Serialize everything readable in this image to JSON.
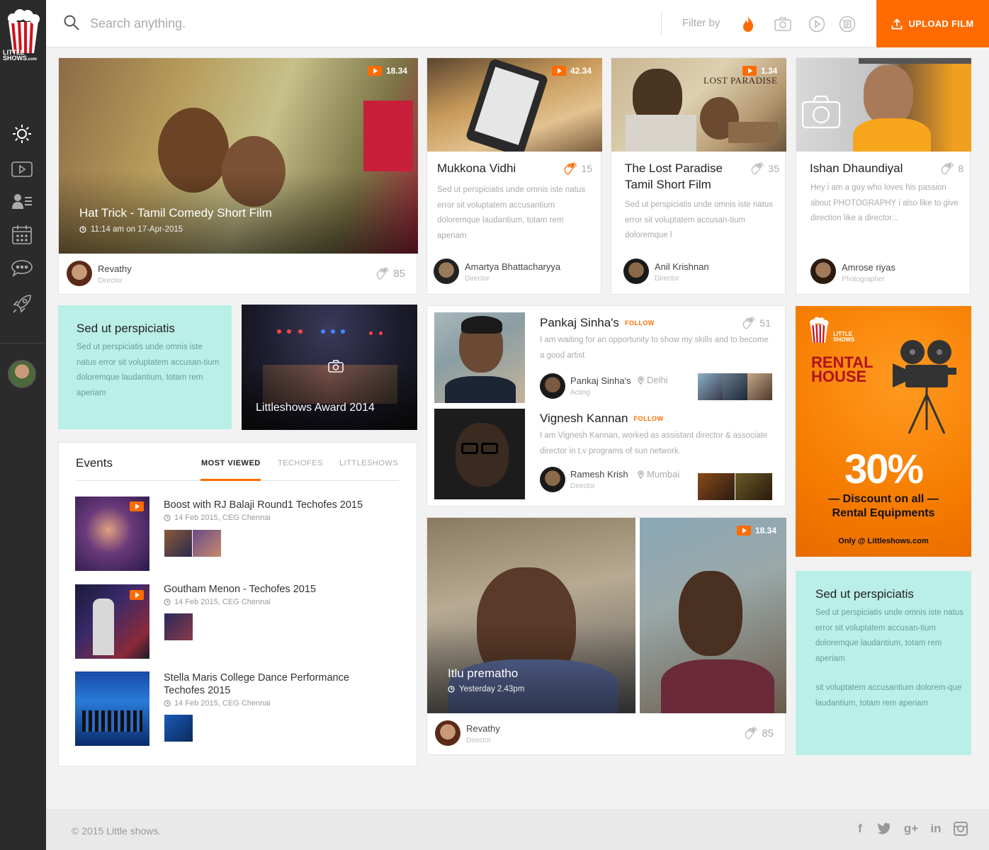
{
  "brand": {
    "logo_text_1": "LITTLE",
    "logo_text_2": "SHOWS",
    "logo_suffix": ".com"
  },
  "search": {
    "placeholder": "Search anything."
  },
  "filter": {
    "label": "Filter by",
    "options": [
      "trending-icon",
      "camera-icon",
      "play-icon",
      "document-icon"
    ]
  },
  "upload": {
    "label": "UPLOAD FILM"
  },
  "sidebar": {
    "items": [
      "sun-icon",
      "video-icon",
      "profiles-icon",
      "calendar-icon",
      "chat-icon",
      "rocket-icon"
    ]
  },
  "featured": {
    "title": "Hat Trick - Tamil Comedy Short Film",
    "time": "11:14 am on 17-Apr-2015",
    "duration": "18.34",
    "author": "Revathy",
    "role": "Director",
    "claps": "85"
  },
  "cards": [
    {
      "title": "Mukkona Vidhi",
      "duration": "42.34",
      "claps": "15",
      "desc": "Sed ut perspiciatis unde omnis iste natus error sit voluptatem accusantium doloremque laudantium, totam rem aperiam",
      "author": "Amartya Bhattacharyya",
      "role": "Director"
    },
    {
      "title": "The Lost Paradise Tamil Short Film",
      "duration": "1.34",
      "claps": "35",
      "desc": "Sed ut perspiciatis unde omnis iste natus error sit voluptatem accusan-tium doloremque l",
      "author": "Anil Krishnan",
      "role": "Director",
      "poster_text": "LOST PARADISE"
    },
    {
      "title": "Ishan Dhaundiyal",
      "claps": "8",
      "desc": "Hey i am a guy who loves his passion about PHOTOGRAPHY i also like to give direction like a director...",
      "author": "Amrose riyas",
      "role": "Photographer"
    }
  ],
  "promo": {
    "title": "Sed ut perspiciatis",
    "text": "Sed ut perspiciatis unde omnis iste natus error sit voluptatem accusan-tium doloremque laudantium, totam rem aperiam"
  },
  "award": {
    "title": "Littleshows Award 2014"
  },
  "people": [
    {
      "name": "Pankaj Sinha's",
      "follow": "FOLLOW",
      "claps": "51",
      "bio": "I am waiting for an opportunity to show my skills and to become a good artist",
      "member": "Pankaj Sinha's",
      "member_role": "Acting",
      "location": "Delhi"
    },
    {
      "name": "Vignesh Kannan",
      "follow": "FOLLOW",
      "bio": "I am Vignesh Kannan, worked as assistant director & associate director in t.v programs of sun network.",
      "member": "Ramesh Krish",
      "member_role": "Director",
      "location": "Mumbai"
    }
  ],
  "ad": {
    "brand": "LITTLE SHOWS",
    "title_1": "RENTAL",
    "title_2": "HOUSE",
    "percent": "30%",
    "line_1": "— Discount on all —",
    "line_2": "Rental Equipments",
    "footer": "Only @ Littleshows.com"
  },
  "events": {
    "heading": "Events",
    "tabs": [
      "MOST VIEWED",
      "TECHOFES",
      "LITTLESHOWS"
    ],
    "items": [
      {
        "title": "Boost with RJ Balaji Round1 Techofes 2015",
        "date": "14 Feb 2015, CEG Chennai"
      },
      {
        "title": "Goutham Menon - Techofes 2015",
        "date": "14 Feb 2015, CEG Chennai"
      },
      {
        "title": "Stella Maris College Dance Performance Techofes 2015",
        "date": "14 Feb 2015, CEG Chennai"
      }
    ]
  },
  "video2": {
    "title": "Itlu prematho",
    "time": "Yesterday 2.43pm",
    "duration": "18.34",
    "author": "Revathy",
    "role": "Director",
    "claps": "85"
  },
  "promo2": {
    "title": "Sed ut perspiciatis",
    "text1": "Sed ut perspiciatis unde omnis iste natus error sit voluptatem accusan-tium doloremque laudantium, totam rem aperiam",
    "text2": "sit voluptatem accusantium dolorem-que laudantium, totam rem aperiam"
  },
  "footer": {
    "copyright": "© 2015 Little shows.",
    "social": [
      "facebook-icon",
      "twitter-icon",
      "google-plus-icon",
      "linkedin-icon",
      "instagram-icon"
    ]
  },
  "colors": {
    "accent": "#ff6b00",
    "mint": "#b9efe6",
    "sidebar": "#2b2b2b"
  }
}
